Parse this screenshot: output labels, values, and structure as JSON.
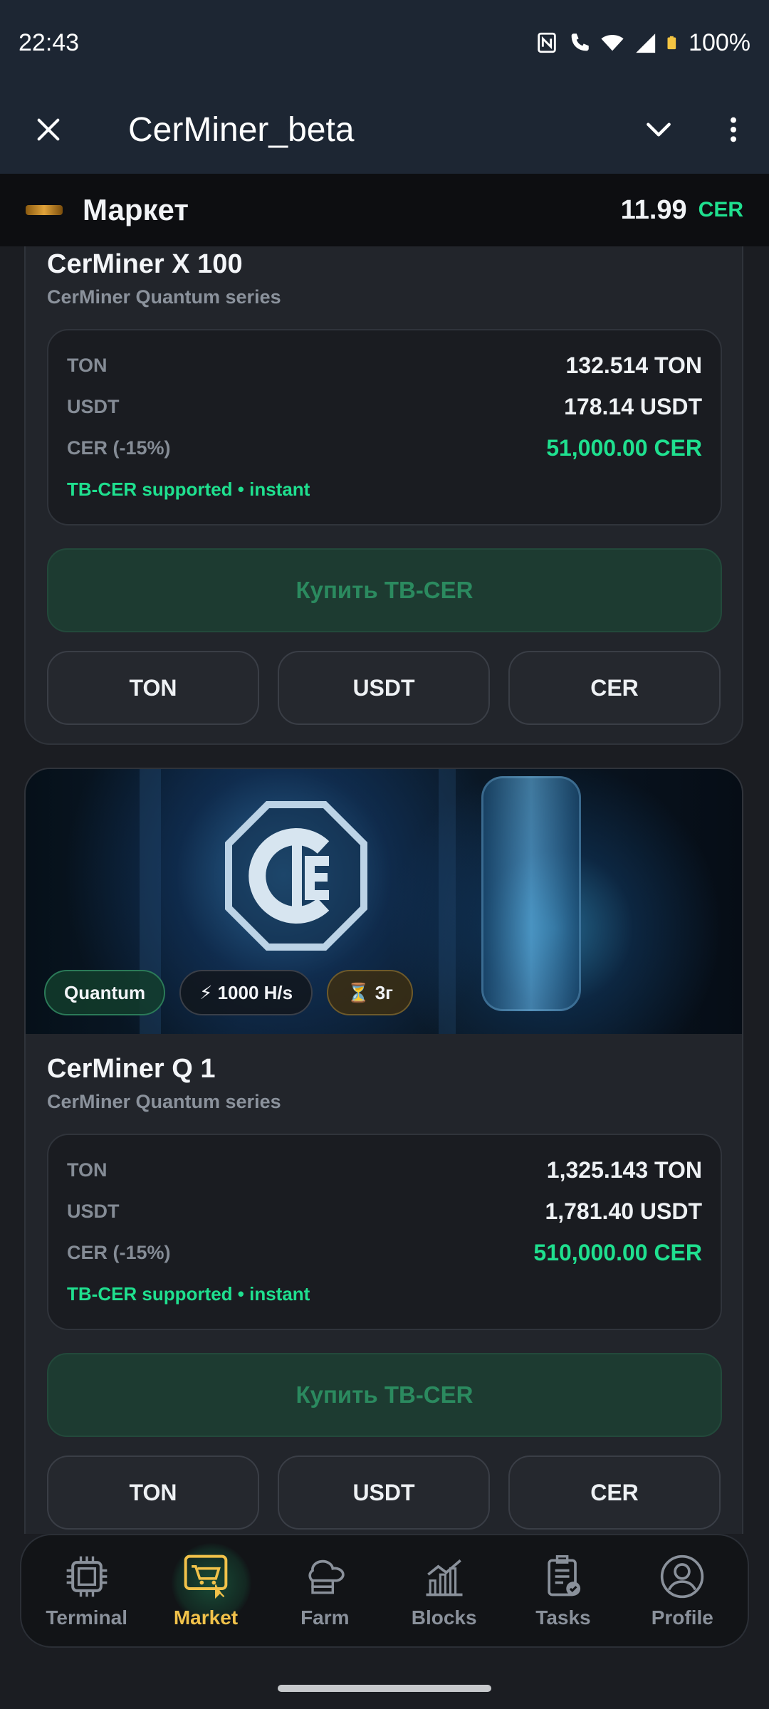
{
  "status_bar": {
    "time": "22:43",
    "battery": "100%",
    "icons": [
      "nfc-icon",
      "call-wifi-icon",
      "wifi-icon",
      "signal-icon",
      "battery-icon"
    ]
  },
  "tg_header": {
    "title": "CerMiner_beta",
    "icons": [
      "close-icon",
      "chevron-down-icon",
      "more-vertical-icon"
    ]
  },
  "app_header": {
    "title": "Маркет",
    "balance": "11.99",
    "balance_unit": "CER"
  },
  "colors": {
    "accent_green": "#1fe08f",
    "active_nav": "#f1c24a",
    "bg": "#1b1d22"
  },
  "products": [
    {
      "name": "CerMiner X 100",
      "series": "CerMiner Quantum series",
      "prices": [
        {
          "label": "TON",
          "value": "132.514 TON"
        },
        {
          "label": "USDT",
          "value": "178.14 USDT"
        },
        {
          "label": "CER (-15%)",
          "value": "51,000.00 CER"
        }
      ],
      "note": "TB-CER supported • instant",
      "buy_label": "Купить TB-CER",
      "pay_buttons": [
        "TON",
        "USDT",
        "CER"
      ]
    },
    {
      "name": "CerMiner Q 1",
      "series": "CerMiner Quantum series",
      "badges": [
        "Quantum",
        "⚡ 1000 H/s",
        "⏳ 3г"
      ],
      "prices": [
        {
          "label": "TON",
          "value": "1,325.143 TON"
        },
        {
          "label": "USDT",
          "value": "1,781.40 USDT"
        },
        {
          "label": "CER (-15%)",
          "value": "510,000.00 CER"
        }
      ],
      "note": "TB-CER supported • instant",
      "buy_label": "Купить TB-CER",
      "pay_buttons": [
        "TON",
        "USDT",
        "CER"
      ]
    }
  ],
  "nav": [
    {
      "label": "Terminal",
      "icon": "chip-icon"
    },
    {
      "label": "Market",
      "icon": "cart-icon",
      "active": true
    },
    {
      "label": "Farm",
      "icon": "farm-icon"
    },
    {
      "label": "Blocks",
      "icon": "chart-icon"
    },
    {
      "label": "Tasks",
      "icon": "clipboard-icon"
    },
    {
      "label": "Profile",
      "icon": "user-icon"
    }
  ]
}
